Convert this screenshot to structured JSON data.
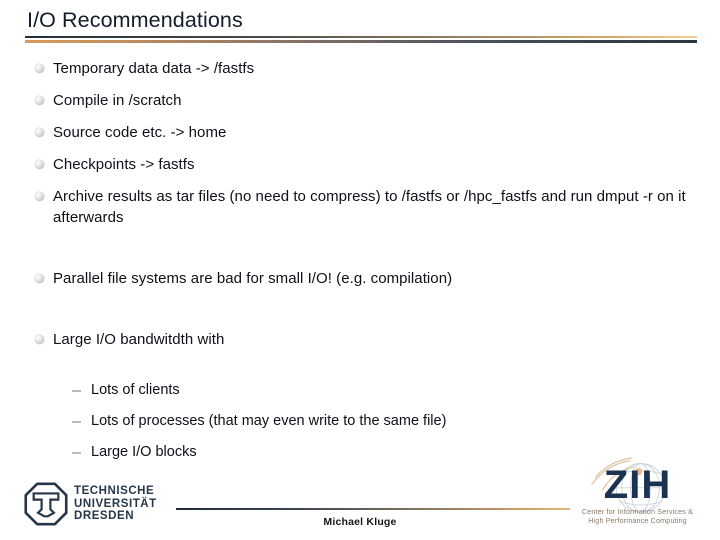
{
  "slide": {
    "title": "I/O Recommendations",
    "bullets": [
      {
        "text": "Temporary data data -> /fastfs"
      },
      {
        "text": "Compile in /scratch"
      },
      {
        "text": "Source code etc. -> home"
      },
      {
        "text": "Checkpoints -> fastfs"
      },
      {
        "text": "Archive results as tar files (no need to compress) to /fastfs or /hpc_fastfs and run dmput -r on it afterwards"
      },
      {
        "text": "Parallel file systems are bad for small I/O! (e.g. compilation)"
      },
      {
        "text": "Large I/O bandwitdth with"
      }
    ],
    "sub_bullets": [
      {
        "text": "Lots of clients"
      },
      {
        "text": "Lots of processes (that may even write to the same file)"
      },
      {
        "text": "Large I/O blocks"
      }
    ]
  },
  "footer": {
    "author": "Michael Kluge"
  },
  "logos": {
    "tu_dresden": {
      "line1": "TECHNISCHE",
      "line2": "UNIVERSITÄT",
      "line3": "DRESDEN",
      "mark_icon": "tud-octagon-icon"
    },
    "zih": {
      "wordmark": "ZIH",
      "caption_line1": "Center for Information Services &",
      "caption_line2": "High Performance Computing",
      "globe_icon": "globe-arcs-icon"
    }
  },
  "colors": {
    "title": "#141d2b",
    "accent_orange": "#d79a5e",
    "accent_navy": "#22303d",
    "logo_navy": "#26374a",
    "zih_navy": "#1b3350",
    "zih_caption": "#8a7a66",
    "bullet_grey": "#d8d8d8"
  }
}
